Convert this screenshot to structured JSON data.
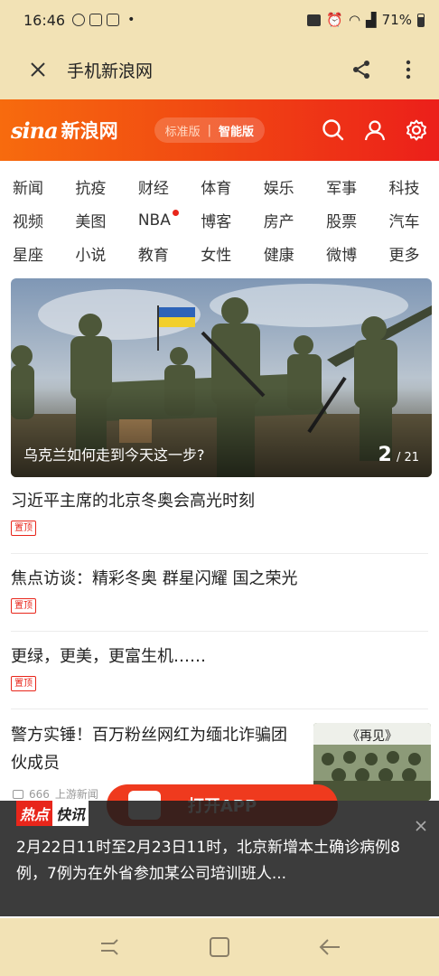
{
  "status": {
    "time": "16:46",
    "battery": "71%"
  },
  "app_bar": {
    "title": "手机新浪网"
  },
  "header": {
    "logo_mark": "sina",
    "logo_text": "新浪网",
    "edition_standard": "标准版",
    "edition_smart": "智能版"
  },
  "nav": {
    "rows": [
      [
        "新闻",
        "抗疫",
        "财经",
        "体育",
        "娱乐",
        "军事",
        "科技"
      ],
      [
        "视频",
        "美图",
        "NBA",
        "博客",
        "房产",
        "股票",
        "汽车"
      ],
      [
        "星座",
        "小说",
        "教育",
        "女性",
        "健康",
        "微博",
        "更多"
      ]
    ]
  },
  "hero": {
    "caption": "乌克兰如何走到今天这一步?",
    "current": "2",
    "total": "/ 21"
  },
  "news": [
    {
      "title": "习近平主席的北京冬奥会高光时刻",
      "badge": "置顶"
    },
    {
      "title": "焦点访谈：精彩冬奥 群星闪耀 国之荣光",
      "badge": "置顶"
    },
    {
      "title": "更绿，更美，更富生机……",
      "badge": "置顶"
    },
    {
      "title": "警方实锤！百万粉丝网红为缅北诈骗团伙成员",
      "comments": "666",
      "source": "上游新闻",
      "thumb_title": "《再见》"
    }
  ],
  "open_app": "打开APP",
  "hot": {
    "tag_a": "热点",
    "tag_b": "快讯",
    "text": "2月22日11时至2月23日11时，北京新增本土确诊病例8例，7例为在外省参加某公司培训班人..."
  },
  "colors": {
    "accent": "#ec1f1a",
    "status_bg": "#f2e2b5"
  }
}
